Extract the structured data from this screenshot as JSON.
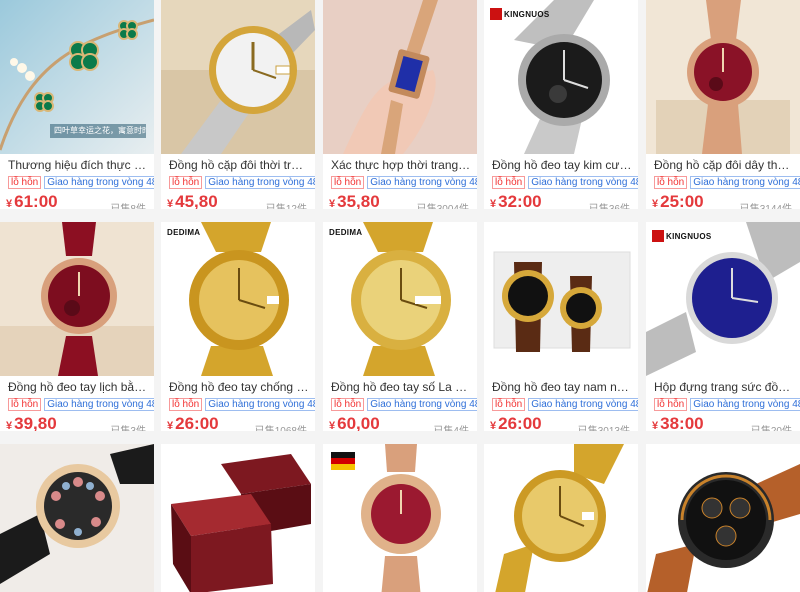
{
  "products": [
    {
      "title": "Thương hiệu đích thực 2023 m...",
      "tag1": "lỗ hỗn",
      "tag2": "Giao hàng trong vòng 48",
      "currency": "¥",
      "price": "61:00",
      "sold": "已售8件",
      "image_caption": "四叶草幸运之花，寓意时时好运"
    },
    {
      "title": "Đồng hồ cặp đôi thời trang dây...",
      "tag1": "lỗ hỗn",
      "tag2": "Giao hàng trong vòng 48",
      "currency": "¥",
      "price": "45,80",
      "sold": "已售12件"
    },
    {
      "title": "Xác thực hợp thời trang dây đe...",
      "tag1": "lỗ hỗn",
      "tag2": "Giao hàng trong vòng 48",
      "currency": "¥",
      "price": "35,80",
      "sold": "已售3004件"
    },
    {
      "title": "Đồng hồ đeo tay kim cương và...",
      "tag1": "lỗ hỗn",
      "tag2": "Giao hàng trong vòng 48",
      "currency": "¥",
      "price": "32:00",
      "sold": "已售36件",
      "brand": "KINGNUOS"
    },
    {
      "title": "Đồng hồ cặp đôi dây thép màu...",
      "tag1": "lỗ hỗn",
      "tag2": "Giao hàng trong vòng 48",
      "currency": "¥",
      "price": "25:00",
      "sold": "已售3144件"
    },
    {
      "title": "Đồng hồ đeo tay lịch bằng thé...",
      "tag1": "lỗ hỗn",
      "tag2": "Giao hàng trong vòng 48",
      "currency": "¥",
      "price": "39,80",
      "sold": "已售3件"
    },
    {
      "title": "Đồng hồ đeo tay chống thấm n...",
      "tag1": "lỗ hỗn",
      "tag2": "Giao hàng trong vòng 48",
      "currency": "¥",
      "price": "26:00",
      "sold": "已售1068件",
      "brand": "DEDIMA"
    },
    {
      "title": "Đồng hồ đeo tay số La Mã mà...",
      "tag1": "lỗ hỗn",
      "tag2": "Giao hàng trong vòng 48",
      "currency": "¥",
      "price": "60,00",
      "sold": "已售4件",
      "brand": "DEDIMA"
    },
    {
      "title": "Đồng hồ đeo tay nam nữ thời t...",
      "tag1": "lỗ hỗn",
      "tag2": "Giao hàng trong vòng 48",
      "currency": "¥",
      "price": "26:00",
      "sold": "已售3013件"
    },
    {
      "title": "Hộp đựng trang sức đồng hồ g...",
      "tag1": "lỗ hỗn",
      "tag2": "Giao hàng trong vòng 48",
      "currency": "¥",
      "price": "38:00",
      "sold": "已售20件",
      "brand": "KINGNUOS"
    },
    {},
    {},
    {},
    {},
    {}
  ]
}
